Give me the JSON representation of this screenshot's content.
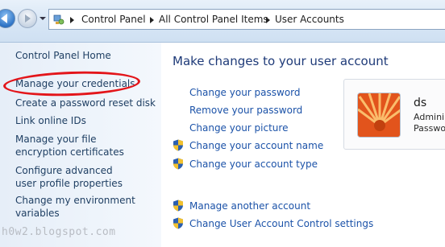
{
  "addressbar": {
    "crumbs": [
      "Control Panel",
      "All Control Panel Items",
      "User Accounts"
    ]
  },
  "leftpane": {
    "home": "Control Panel Home",
    "links": [
      "Manage your credentials",
      "Create a password reset disk",
      "Link online IDs",
      "Manage your file encryption certificates",
      "Configure advanced user profile properties",
      "Change my environment variables"
    ],
    "watermark": "h0w2.blogspot.com"
  },
  "main": {
    "title": "Make changes to your user account",
    "links": [
      "Change your password",
      "Remove your password",
      "Change your picture",
      "Change your account name",
      "Change your account type",
      "Manage another account",
      "Change User Account Control settings"
    ]
  },
  "account": {
    "name": "ds",
    "role_line1": "Admini",
    "role_line2": "Passwo"
  },
  "colors": {
    "link": "#1b52a8",
    "title": "#1e3a78",
    "highlight": "#e3151a"
  }
}
